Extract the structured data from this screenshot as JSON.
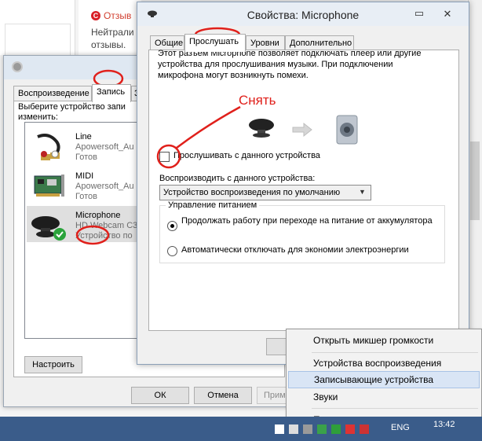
{
  "background_page": {
    "heading": "Отзыв",
    "text_line1": "Нейтрали",
    "text_line2": "отзывы."
  },
  "sound_dialog": {
    "tabs": [
      "Воспроизведение",
      "Запись",
      "З"
    ],
    "active_tab": 1,
    "instruction": "Выберите устройство запи изменить:",
    "devices": [
      {
        "name": "Line",
        "sub1": "Apowersoft_Au",
        "sub2": "Готов"
      },
      {
        "name": "MIDI",
        "sub1": "Apowersoft_Au",
        "sub2": "Готов"
      },
      {
        "name": "Microphone",
        "sub1": "HD Webcam C3",
        "sub2": "Устройство по"
      }
    ],
    "selected_device": 2,
    "configure_button": "Настроить",
    "ok_button": "ОК",
    "cancel_button": "Отмена",
    "apply_button": "Приме"
  },
  "properties_dialog": {
    "title": "Свойства: Microphone",
    "tabs": [
      "Общие",
      "Прослушать",
      "Уровни",
      "Дополнительно"
    ],
    "active_tab": 1,
    "description": "Этот разъем Microphone позволяет подключать плеер или другие устройства для прослушивания музыки. При подключении микрофона могут возникнуть помехи.",
    "listen_checkbox_label": "Прослушивать с данного устройства",
    "listen_checked": false,
    "playback_label": "Воспроизводить с данного устройства:",
    "playback_value": "Устройство воспроизведения по умолчанию",
    "power_group_label": "Управление питанием",
    "power_option1": "Продолжать работу при переходе на питание от аккумулятора",
    "power_option2": "Автоматически отключать для экономии электроэнергии",
    "power_selected": 1
  },
  "context_menu": {
    "items": [
      "Открыть микшер громкости",
      "Устройства воспроизведения",
      "Записывающие устройства",
      "Звуки",
      "Параметры громкости"
    ],
    "highlighted": 2
  },
  "taskbar": {
    "language": "ENG",
    "clock": "13:42"
  },
  "annotation": {
    "text": "Снять",
    "color": "#e0201b"
  },
  "colors": {
    "accent": "#3a5c8a",
    "menu_highlight": "#d9e5f5",
    "selected_row": "#dfdfdf"
  }
}
